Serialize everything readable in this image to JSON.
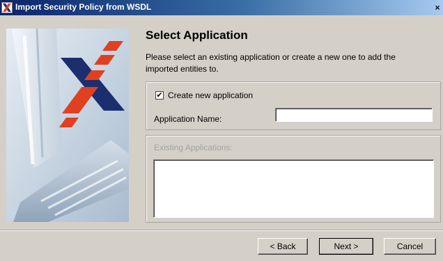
{
  "window": {
    "title": "Import Security Policy from WSDL",
    "close_glyph": "×",
    "app_icon": "x-logo-icon"
  },
  "side_image": {
    "description_icon": "computer-keyboard-x-logo-illustration"
  },
  "page": {
    "heading": "Select Application",
    "description": "Please select an existing application or create a new one to add the imported entities to."
  },
  "create_section": {
    "checkbox_label": "Create new application",
    "checkbox_checked": true,
    "checkbox_glyph": "✔",
    "name_label": "Application Name:",
    "name_value": ""
  },
  "existing_section": {
    "label": "Existing Applications:",
    "items": []
  },
  "buttons": {
    "back": "< Back",
    "next": "Next >",
    "cancel": "Cancel"
  },
  "colors": {
    "dialog_bg": "#d4d0c8",
    "accent_red": "#e0401f",
    "accent_navy": "#1c2e6e",
    "titlebar_start": "#0a246a"
  }
}
